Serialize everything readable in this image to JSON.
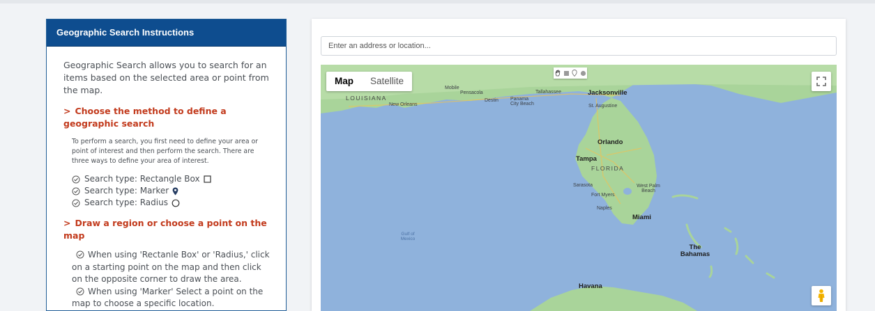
{
  "panel": {
    "title": "Geographic Search Instructions",
    "intro": "Geographic Search allows you to search for an items based on the selected area or point from the map.",
    "section1": {
      "title": "Choose the method to define a geographic search",
      "desc": "To perform a search, you first need to define your area or point of interest and then perform the search. There are three ways to define your area of interest.",
      "types": [
        {
          "label": "Search type: Rectangle Box",
          "icon": "square-icon"
        },
        {
          "label": "Search type: Marker",
          "icon": "map-marker-icon"
        },
        {
          "label": "Search type: Radius",
          "icon": "circle-icon"
        }
      ]
    },
    "section2": {
      "title": "Draw a region or choose a point on the map",
      "tips": [
        "When using 'Rectanle Box' or 'Radius,' click on a starting point on the map and then click on the opposite corner to draw the area.",
        "When using 'Marker' Select a point on the map to choose a specific location."
      ]
    }
  },
  "search": {
    "placeholder": "Enter an address or location..."
  },
  "map": {
    "type_buttons": {
      "map": "Map",
      "satellite": "Satellite"
    },
    "draw_tools": [
      "hand-icon",
      "rectangle-icon",
      "marker-icon",
      "circle-icon"
    ],
    "labels": {
      "louisiana": "LOUISIANA",
      "new_orleans": "New Orleans",
      "mobile": "Mobile",
      "pensacola": "Pensacola",
      "destin": "Destin",
      "panama_city": "Panama City Beach",
      "tallahassee": "Tallahassee",
      "jacksonville": "Jacksonville",
      "st_augustine": "St. Augustine",
      "orlando": "Orlando",
      "tampa": "Tampa",
      "florida": "FLORIDA",
      "sarasota": "Sarasota",
      "west_palm": "West Palm Beach",
      "fort_myers": "Fort Myers",
      "naples": "Naples",
      "miami": "Miami",
      "gulf": "Gulf of Mexico",
      "bahamas": "The Bahamas",
      "havana": "Havana"
    }
  },
  "colors": {
    "header_bg": "#0e4d8f",
    "accent": "#c23a1c",
    "water": "#8fb2dc",
    "land": "#a9d49a"
  }
}
